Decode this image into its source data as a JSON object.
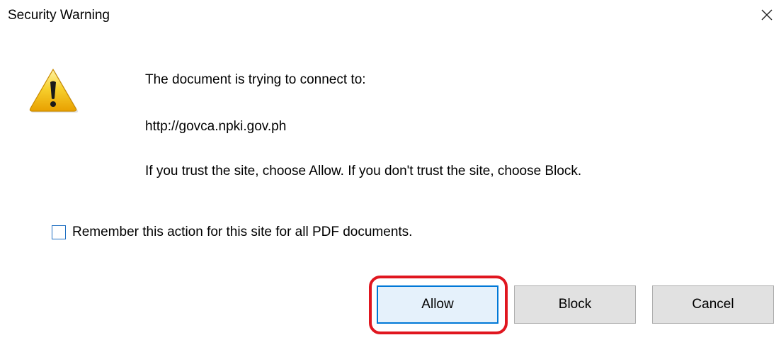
{
  "dialog": {
    "title": "Security Warning",
    "close_icon": "close-icon",
    "warning_icon": "warning-icon",
    "message_line_1": "The document is trying to connect to:",
    "url": "http://govca.npki.gov.ph",
    "message_line_2": "If you trust the site, choose Allow. If you don't trust the site, choose Block.",
    "remember_label": "Remember this action for this site for all PDF documents.",
    "remember_checked": false
  },
  "buttons": {
    "allow_label": "Allow",
    "block_label": "Block",
    "cancel_label": "Cancel"
  },
  "colors": {
    "highlight": "#e0161f",
    "focus_border": "#0078d7",
    "checkbox_border": "#1f6fc2",
    "button_face": "#e1e1e1"
  }
}
